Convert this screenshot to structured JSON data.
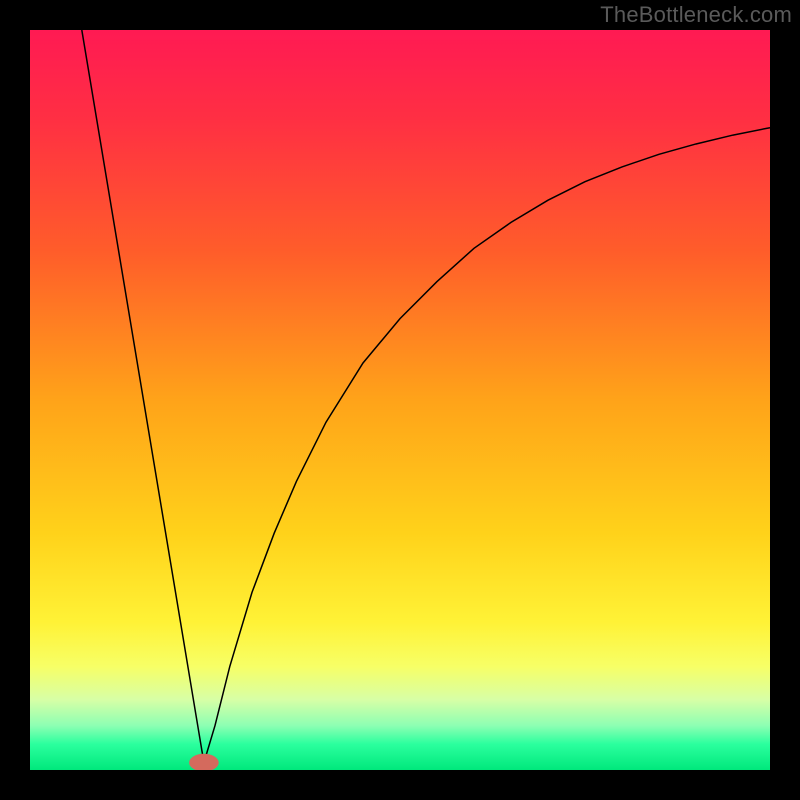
{
  "watermark": "TheBottleneck.com",
  "chart_data": {
    "type": "line",
    "title": "",
    "xlabel": "",
    "ylabel": "",
    "xlim": [
      0,
      100
    ],
    "ylim": [
      0,
      100
    ],
    "grid": false,
    "legend": false,
    "background_gradient": {
      "stops": [
        {
          "offset": 0.0,
          "color": "#ff1a53"
        },
        {
          "offset": 0.12,
          "color": "#ff2f43"
        },
        {
          "offset": 0.3,
          "color": "#ff5d2a"
        },
        {
          "offset": 0.5,
          "color": "#ffa319"
        },
        {
          "offset": 0.68,
          "color": "#ffd21a"
        },
        {
          "offset": 0.8,
          "color": "#fff236"
        },
        {
          "offset": 0.86,
          "color": "#f7ff66"
        },
        {
          "offset": 0.905,
          "color": "#d7ffa6"
        },
        {
          "offset": 0.94,
          "color": "#8dffb3"
        },
        {
          "offset": 0.965,
          "color": "#2bff9e"
        },
        {
          "offset": 1.0,
          "color": "#00e87c"
        }
      ]
    },
    "marker": {
      "x": 23.5,
      "y": 1.0,
      "rx": 2.0,
      "ry": 1.2,
      "color": "#d46a5d"
    },
    "series": [
      {
        "name": "bottleneck-curve",
        "color": "#000000",
        "width": 1.5,
        "x": [
          7.0,
          10,
          13,
          16,
          19,
          21,
          22.5,
          23.5,
          25,
          27,
          30,
          33,
          36,
          40,
          45,
          50,
          55,
          60,
          65,
          70,
          75,
          80,
          85,
          90,
          95,
          100
        ],
        "values": [
          100,
          82,
          64,
          46,
          28,
          16,
          7,
          1.0,
          6,
          14,
          24,
          32,
          39,
          47,
          55,
          61,
          66,
          70.5,
          74,
          77,
          79.5,
          81.5,
          83.2,
          84.6,
          85.8,
          86.8
        ]
      }
    ]
  }
}
